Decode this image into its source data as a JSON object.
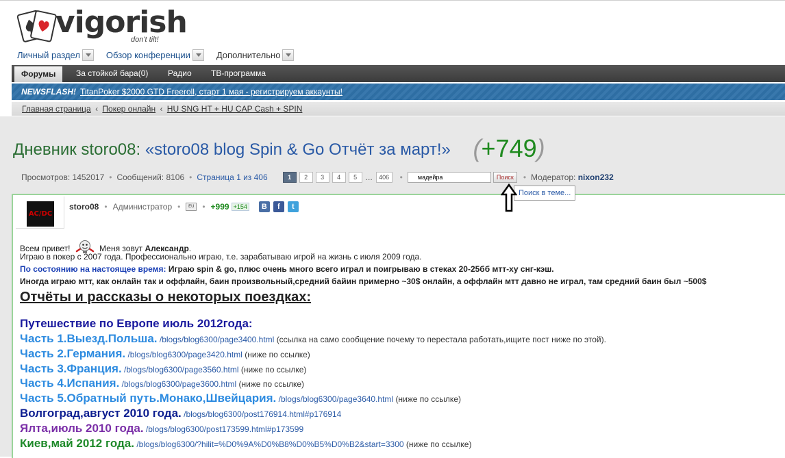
{
  "brand": {
    "name": "vigorish",
    "tagline": "don't tilt!"
  },
  "topnav": [
    {
      "label": "Личный раздел"
    },
    {
      "label": "Обзор конференции"
    },
    {
      "label": "Дополнительно"
    }
  ],
  "menubar": [
    {
      "label": "Форумы",
      "active": true
    },
    {
      "label": "За стойкой бара(0)"
    },
    {
      "label": "Радио"
    },
    {
      "label": "ТВ-программа"
    }
  ],
  "newsflash": {
    "label": "NEWSFLASH!",
    "text": "TitanPoker $2000 GTD Freeroll, старт 1 мая - регистрируем аккаунты!"
  },
  "breadcrumb": [
    "Главная страница",
    "Покер онлайн",
    "HU SNG HT + HU CAP Cash + SPIN"
  ],
  "breadcrumb_sep": "‹",
  "title": {
    "prefix": "Дневник storo08:",
    "quote": "«storo08 blog Spin & Go Отчёт за март!»",
    "paren_open": "(",
    "rating": "+749",
    "paren_close": ")"
  },
  "stats": {
    "views": "Просмотров: 1452017",
    "messages": "Сообщений: 8106",
    "page": "Страница 1 из 406",
    "pages": [
      "1",
      "2",
      "3",
      "4",
      "5"
    ],
    "ellipsis": "...",
    "last_page": "406",
    "dot": "•",
    "search_value": "мадейра",
    "search_button": "Поиск",
    "moderator_label": "Модератор:",
    "moderator": "nixon232"
  },
  "tooltip": "Поиск в теме...",
  "post": {
    "avatar_text": "AC/DC",
    "username": "storo08",
    "role": "Администратор",
    "flag": "EU",
    "rep": "+999",
    "rep_small": "+154",
    "social": [
      "В",
      "f",
      "t"
    ],
    "greeting_pre": "Всем привет!",
    "greeting_mid": "Меня зовут",
    "greeting_name": "Александр",
    "greeting_end": ".",
    "line2": "Играю в покер с 2007 года. Профессионально играю, т.е. зарабатываю игрой на жизнь с июля 2009 года.",
    "line3_label": "По состоянию на настоящее время:",
    "line3_text": "Играю spin & go, плюс очень много всего играл и поигрываю в стеках 20-25бб мтт-ху снг-кэш.",
    "line4": "Иногда играю мтт, как онлайн так и оффлайн, баин произвольный,средний байин примерно ~30$ онлайн, а оффлайн мтт давно не играл, там средний баин был ~500$",
    "reports_heading": "Отчёты и рассказы о некоторых поездках:",
    "trip_heading": "Путешествие по Европе июль 2012года:",
    "entries": [
      {
        "title": "Часть 1.Выезд.Польша.",
        "url": "/blogs/blog6300/page3400.html",
        "note": "(ссылка на само сообщение почему то перестала работать,ищите пост ниже по этой)."
      },
      {
        "title": "Часть 2.Германия.",
        "url": "/blogs/blog6300/page3420.html",
        "note": "(ниже по ссылке)"
      },
      {
        "title": "Часть 3.Франция.",
        "url": "/blogs/blog6300/page3560.html",
        "note": "(ниже по ссылке)"
      },
      {
        "title": "Часть 4.Испания.",
        "url": "/blogs/blog6300/page3600.html",
        "note": "(ниже по ссылке)"
      },
      {
        "title": "Часть 5.Обратный путь.Монако,Швейцария.",
        "url": "/blogs/blog6300/page3640.html",
        "note": "(ниже по ссылке)"
      },
      {
        "title": "Волгоград,август 2010 года.",
        "url": "/blogs/blog6300/post176914.html#p176914",
        "note": ""
      },
      {
        "title": "Ялта,июль 2010 года.",
        "url": "/blogs/blog6300/post173599.html#p173599",
        "note": ""
      },
      {
        "title": "Киев,май 2012 года.",
        "url": "/blogs/blog6300/?hilit=%D0%9A%D0%B8%D0%B5%D0%B2&start=3300",
        "note": "(ниже по ссылке)"
      }
    ]
  }
}
